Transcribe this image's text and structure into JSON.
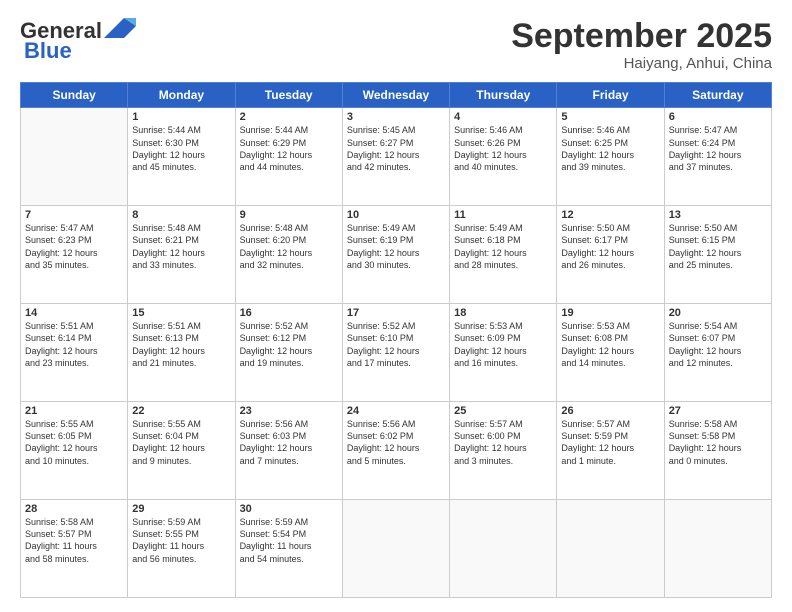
{
  "logo": {
    "line1": "General",
    "line2": "Blue"
  },
  "header": {
    "month": "September 2025",
    "location": "Haiyang, Anhui, China"
  },
  "days_of_week": [
    "Sunday",
    "Monday",
    "Tuesday",
    "Wednesday",
    "Thursday",
    "Friday",
    "Saturday"
  ],
  "weeks": [
    [
      {
        "day": "",
        "content": ""
      },
      {
        "day": "1",
        "content": "Sunrise: 5:44 AM\nSunset: 6:30 PM\nDaylight: 12 hours\nand 45 minutes."
      },
      {
        "day": "2",
        "content": "Sunrise: 5:44 AM\nSunset: 6:29 PM\nDaylight: 12 hours\nand 44 minutes."
      },
      {
        "day": "3",
        "content": "Sunrise: 5:45 AM\nSunset: 6:27 PM\nDaylight: 12 hours\nand 42 minutes."
      },
      {
        "day": "4",
        "content": "Sunrise: 5:46 AM\nSunset: 6:26 PM\nDaylight: 12 hours\nand 40 minutes."
      },
      {
        "day": "5",
        "content": "Sunrise: 5:46 AM\nSunset: 6:25 PM\nDaylight: 12 hours\nand 39 minutes."
      },
      {
        "day": "6",
        "content": "Sunrise: 5:47 AM\nSunset: 6:24 PM\nDaylight: 12 hours\nand 37 minutes."
      }
    ],
    [
      {
        "day": "7",
        "content": "Sunrise: 5:47 AM\nSunset: 6:23 PM\nDaylight: 12 hours\nand 35 minutes."
      },
      {
        "day": "8",
        "content": "Sunrise: 5:48 AM\nSunset: 6:21 PM\nDaylight: 12 hours\nand 33 minutes."
      },
      {
        "day": "9",
        "content": "Sunrise: 5:48 AM\nSunset: 6:20 PM\nDaylight: 12 hours\nand 32 minutes."
      },
      {
        "day": "10",
        "content": "Sunrise: 5:49 AM\nSunset: 6:19 PM\nDaylight: 12 hours\nand 30 minutes."
      },
      {
        "day": "11",
        "content": "Sunrise: 5:49 AM\nSunset: 6:18 PM\nDaylight: 12 hours\nand 28 minutes."
      },
      {
        "day": "12",
        "content": "Sunrise: 5:50 AM\nSunset: 6:17 PM\nDaylight: 12 hours\nand 26 minutes."
      },
      {
        "day": "13",
        "content": "Sunrise: 5:50 AM\nSunset: 6:15 PM\nDaylight: 12 hours\nand 25 minutes."
      }
    ],
    [
      {
        "day": "14",
        "content": "Sunrise: 5:51 AM\nSunset: 6:14 PM\nDaylight: 12 hours\nand 23 minutes."
      },
      {
        "day": "15",
        "content": "Sunrise: 5:51 AM\nSunset: 6:13 PM\nDaylight: 12 hours\nand 21 minutes."
      },
      {
        "day": "16",
        "content": "Sunrise: 5:52 AM\nSunset: 6:12 PM\nDaylight: 12 hours\nand 19 minutes."
      },
      {
        "day": "17",
        "content": "Sunrise: 5:52 AM\nSunset: 6:10 PM\nDaylight: 12 hours\nand 17 minutes."
      },
      {
        "day": "18",
        "content": "Sunrise: 5:53 AM\nSunset: 6:09 PM\nDaylight: 12 hours\nand 16 minutes."
      },
      {
        "day": "19",
        "content": "Sunrise: 5:53 AM\nSunset: 6:08 PM\nDaylight: 12 hours\nand 14 minutes."
      },
      {
        "day": "20",
        "content": "Sunrise: 5:54 AM\nSunset: 6:07 PM\nDaylight: 12 hours\nand 12 minutes."
      }
    ],
    [
      {
        "day": "21",
        "content": "Sunrise: 5:55 AM\nSunset: 6:05 PM\nDaylight: 12 hours\nand 10 minutes."
      },
      {
        "day": "22",
        "content": "Sunrise: 5:55 AM\nSunset: 6:04 PM\nDaylight: 12 hours\nand 9 minutes."
      },
      {
        "day": "23",
        "content": "Sunrise: 5:56 AM\nSunset: 6:03 PM\nDaylight: 12 hours\nand 7 minutes."
      },
      {
        "day": "24",
        "content": "Sunrise: 5:56 AM\nSunset: 6:02 PM\nDaylight: 12 hours\nand 5 minutes."
      },
      {
        "day": "25",
        "content": "Sunrise: 5:57 AM\nSunset: 6:00 PM\nDaylight: 12 hours\nand 3 minutes."
      },
      {
        "day": "26",
        "content": "Sunrise: 5:57 AM\nSunset: 5:59 PM\nDaylight: 12 hours\nand 1 minute."
      },
      {
        "day": "27",
        "content": "Sunrise: 5:58 AM\nSunset: 5:58 PM\nDaylight: 12 hours\nand 0 minutes."
      }
    ],
    [
      {
        "day": "28",
        "content": "Sunrise: 5:58 AM\nSunset: 5:57 PM\nDaylight: 11 hours\nand 58 minutes."
      },
      {
        "day": "29",
        "content": "Sunrise: 5:59 AM\nSunset: 5:55 PM\nDaylight: 11 hours\nand 56 minutes."
      },
      {
        "day": "30",
        "content": "Sunrise: 5:59 AM\nSunset: 5:54 PM\nDaylight: 11 hours\nand 54 minutes."
      },
      {
        "day": "",
        "content": ""
      },
      {
        "day": "",
        "content": ""
      },
      {
        "day": "",
        "content": ""
      },
      {
        "day": "",
        "content": ""
      }
    ]
  ]
}
